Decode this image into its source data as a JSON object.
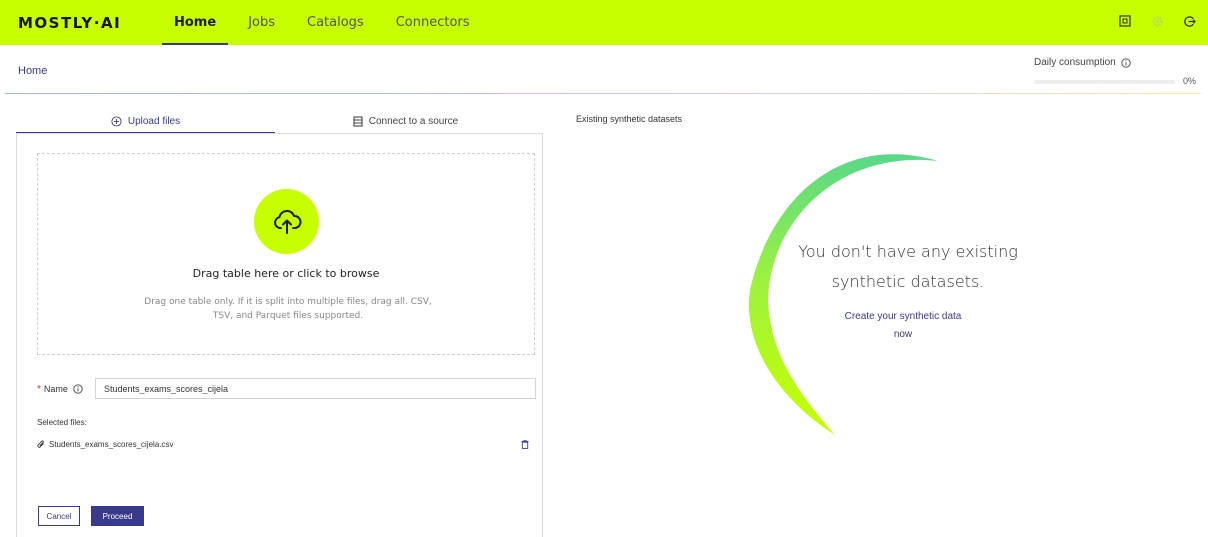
{
  "app": {
    "logo_text": "MOSTLY·AI",
    "nav": [
      "Home",
      "Jobs",
      "Catalogs",
      "Connectors"
    ],
    "active_nav": "Home",
    "accent_color": "#c8ff00",
    "primary_color": "#3a3a8c"
  },
  "header": {
    "breadcrumb": "Home",
    "consumption_label": "Daily consumption",
    "consumption_percent": "0%",
    "consumption_value": 0
  },
  "upload": {
    "tab_upload": "Upload files",
    "tab_connect": "Connect to a source",
    "drop_title": "Drag table here or click to browse",
    "drop_hint": "Drag one table only. If it is split into multiple files, drag all. CSV, TSV, and Parquet files supported.",
    "name_label": "Name",
    "name_value": "Students_exams_scores_cijela",
    "selected_files_label": "Selected files:",
    "files": [
      {
        "name": "Students_exams_scores_cijela.csv"
      }
    ],
    "cancel_label": "Cancel",
    "proceed_label": "Proceed"
  },
  "existing": {
    "title": "Existing synthetic datasets",
    "empty_line1": "You don't have any existing",
    "empty_line2": "synthetic datasets.",
    "create_line1": "Create your synthetic data",
    "create_line2": "now"
  }
}
